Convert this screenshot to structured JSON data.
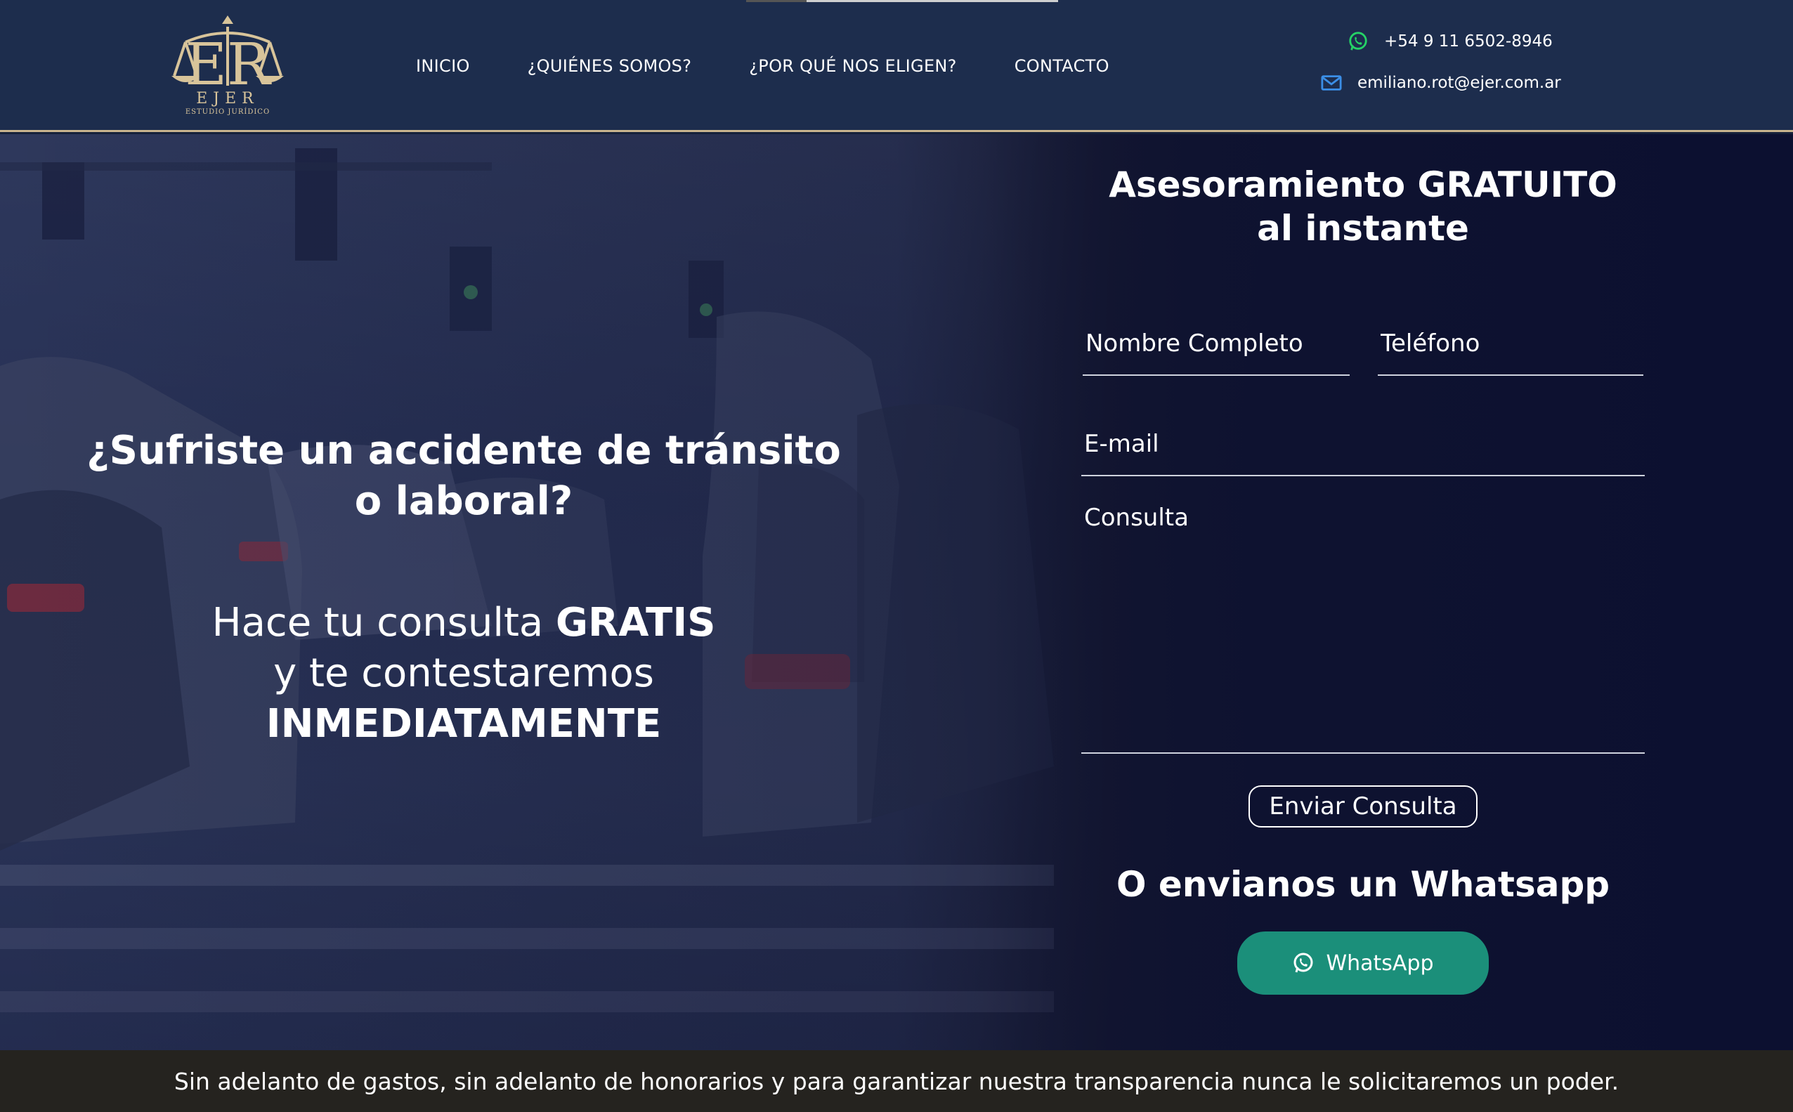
{
  "header": {
    "logo": {
      "name": "EJER",
      "subtitle": "ESTUDIO JURÍDICO"
    },
    "nav": [
      {
        "label": "INICIO"
      },
      {
        "label": "¿QUIÉNES SOMOS?"
      },
      {
        "label": "¿POR QUÉ NOS ELIGEN?"
      },
      {
        "label": "CONTACTO"
      }
    ],
    "phone": {
      "icon": "whatsapp-icon",
      "text": "+54 9 11 6502-8946",
      "icon_color": "#25d366"
    },
    "email": {
      "icon": "envelope-icon",
      "text": "emiliano.rot@ejer.com.ar",
      "icon_color": "#3b8ee6"
    }
  },
  "hero": {
    "headline_line1": "¿Sufriste un accidente de tránsito",
    "headline_line2": "o laboral?",
    "sub_line1_normal": "Hace tu consulta ",
    "sub_line1_bold": "GRATIS",
    "sub_line2": "y te contestaremos",
    "sub_line3_bold": "INMEDIATAMENTE"
  },
  "form": {
    "title_normal": "Asesoramiento ",
    "title_bold": "GRATUITO",
    "title_line2": "al instante",
    "name_placeholder": "Nombre Completo",
    "phone_placeholder": "Teléfono",
    "email_placeholder": "E-mail",
    "message_placeholder": "Consulta",
    "submit_label": "Enviar Consulta",
    "whatsapp_title": "O envianos un Whatsapp",
    "whatsapp_button": "WhatsApp",
    "whatsapp_button_color": "#1b8f7a"
  },
  "band": {
    "text": "Sin adelanto de gastos, sin adelanto de honorarios y para garantizar nuestra transparencia nunca le solicitaremos un poder."
  },
  "colors": {
    "header_bg": "#1d2d4d",
    "accent_gold": "#c9b48e",
    "band_bg": "#25231f"
  }
}
